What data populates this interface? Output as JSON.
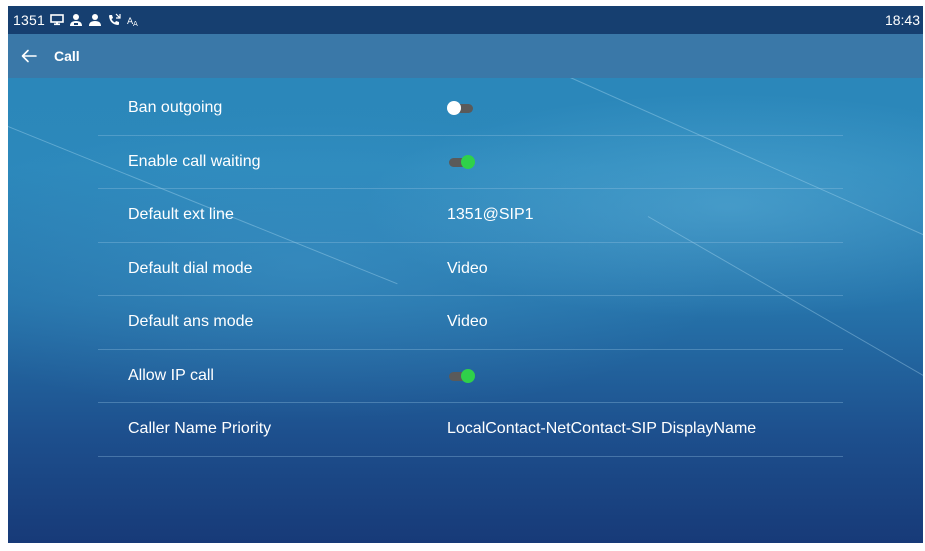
{
  "status_bar": {
    "extension": "1351",
    "time": "18:43",
    "icons": [
      "monitor-icon",
      "contact-icon",
      "person-icon",
      "call-forward-icon",
      "auto-answer-icon"
    ]
  },
  "header": {
    "back_icon": "arrow-left-icon",
    "title": "Call"
  },
  "settings": [
    {
      "label": "Ban outgoing",
      "type": "toggle",
      "on": false
    },
    {
      "label": "Enable call waiting",
      "type": "toggle",
      "on": true
    },
    {
      "label": "Default ext line",
      "type": "value",
      "value": "1351@SIP1"
    },
    {
      "label": "Default dial mode",
      "type": "value",
      "value": "Video"
    },
    {
      "label": "Default ans mode",
      "type": "value",
      "value": "Video"
    },
    {
      "label": "Allow IP call",
      "type": "toggle",
      "on": true
    },
    {
      "label": "Caller Name Priority",
      "type": "value",
      "value": "LocalContact-NetContact-SIP DisplayName"
    }
  ],
  "colors": {
    "status_bar": "#163f70",
    "title_bar": "#3a78a8",
    "toggle_on": "#2fd14a",
    "toggle_off_knob": "#ffffff",
    "toggle_track": "#5a5a5a"
  }
}
